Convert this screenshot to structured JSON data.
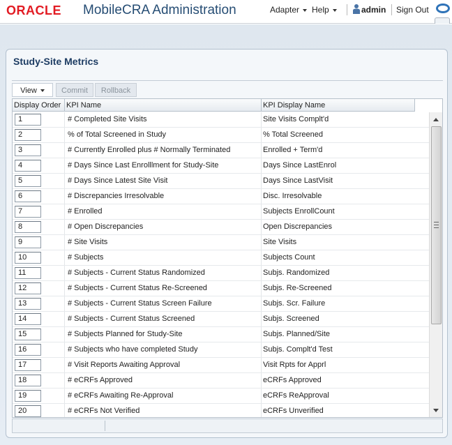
{
  "header": {
    "logo_text": "ORACLE",
    "app_title": "MobileCRA Administration",
    "menus": [
      {
        "label": "Adapter"
      },
      {
        "label": "Help"
      }
    ],
    "user": "admin",
    "sign_out": "Sign Out",
    "brand_color": "#e21b23",
    "title_color": "#264d74"
  },
  "panel": {
    "title": "Study-Site Metrics"
  },
  "toolbar": {
    "view_label": "View",
    "commit_label": "Commit",
    "rollback_label": "Rollback"
  },
  "table": {
    "columns": [
      "Display Order",
      "KPI Name",
      "KPI Display Name"
    ],
    "rows": [
      {
        "order": "1",
        "kpi_name": "# Completed Site Visits",
        "display_name": "Site Visits Complt'd"
      },
      {
        "order": "2",
        "kpi_name": "% of Total Screened in Study",
        "display_name": "% Total Screened"
      },
      {
        "order": "3",
        "kpi_name": "# Currently Enrolled plus # Normally Terminated",
        "display_name": "Enrolled + Term'd"
      },
      {
        "order": "4",
        "kpi_name": "# Days Since Last Enrolllment for Study-Site",
        "display_name": "Days Since LastEnrol"
      },
      {
        "order": "5",
        "kpi_name": "# Days Since Latest Site Visit",
        "display_name": "Days Since LastVisit"
      },
      {
        "order": "6",
        "kpi_name": "# Discrepancies Irresolvable",
        "display_name": "Disc. Irresolvable"
      },
      {
        "order": "7",
        "kpi_name": "# Enrolled",
        "display_name": "Subjects EnrollCount"
      },
      {
        "order": "8",
        "kpi_name": "# Open Discrepancies",
        "display_name": "Open Discrepancies"
      },
      {
        "order": "9",
        "kpi_name": "# Site Visits",
        "display_name": "Site Visits"
      },
      {
        "order": "10",
        "kpi_name": "# Subjects",
        "display_name": "Subjects Count"
      },
      {
        "order": "11",
        "kpi_name": "# Subjects - Current Status Randomized",
        "display_name": "Subjs. Randomized"
      },
      {
        "order": "12",
        "kpi_name": "# Subjects - Current Status Re-Screened",
        "display_name": "Subjs. Re-Screened"
      },
      {
        "order": "13",
        "kpi_name": "# Subjects - Current Status Screen Failure",
        "display_name": "Subjs. Scr. Failure"
      },
      {
        "order": "14",
        "kpi_name": "# Subjects - Current Status Screened",
        "display_name": "Subjs. Screened"
      },
      {
        "order": "15",
        "kpi_name": "# Subjects Planned for Study-Site",
        "display_name": "Subjs. Planned/Site"
      },
      {
        "order": "16",
        "kpi_name": "# Subjects who have completed Study",
        "display_name": "Subjs. Complt'd Test"
      },
      {
        "order": "17",
        "kpi_name": "# Visit Reports Awaiting Approval",
        "display_name": "Visit Rpts for Apprl"
      },
      {
        "order": "18",
        "kpi_name": "# eCRFs Approved",
        "display_name": "eCRFs Approved"
      },
      {
        "order": "19",
        "kpi_name": "# eCRFs Awaiting Re-Approval",
        "display_name": "eCRFs ReApproval"
      },
      {
        "order": "20",
        "kpi_name": "# eCRFs Not Verified",
        "display_name": "eCRFs Unverified"
      }
    ]
  }
}
